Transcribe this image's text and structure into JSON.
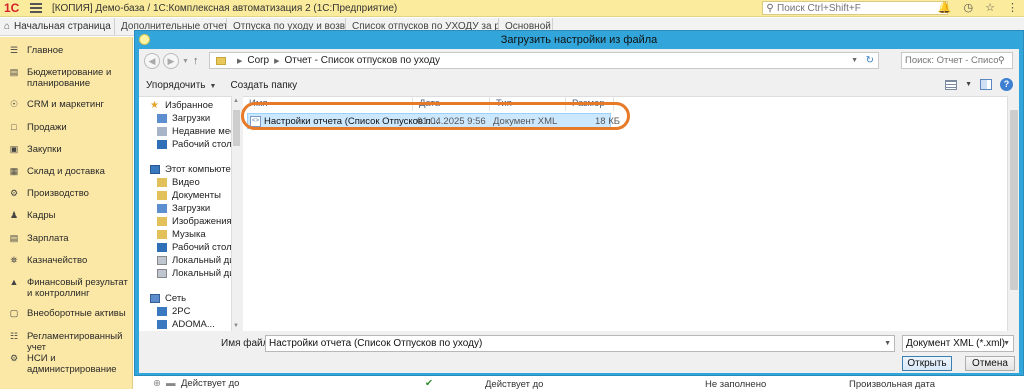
{
  "app": {
    "logo": "1С",
    "title": "[КОПИЯ] Демо-база / 1С:Комплексная автоматизация 2  (1С:Предприятие)",
    "search_placeholder": "Поиск Ctrl+Shift+F"
  },
  "tabs": {
    "home": "Начальная страница",
    "items": [
      "Дополнительные отчеты и обработки",
      "Отпуска по уходу и возврат из отпуска",
      "Список отпусков по УХОДУ за ребенком (Дополнительный отчет)",
      "Основной"
    ]
  },
  "sidebar": {
    "items": [
      {
        "label": "Главное",
        "icon": "menu-icon"
      },
      {
        "label": "Бюджетирование и планирование",
        "icon": "budget-icon"
      },
      {
        "label": "CRM и маркетинг",
        "icon": "crm-icon"
      },
      {
        "label": "Продажи",
        "icon": "sales-icon"
      },
      {
        "label": "Закупки",
        "icon": "purchases-icon"
      },
      {
        "label": "Склад и доставка",
        "icon": "warehouse-icon"
      },
      {
        "label": "Производство",
        "icon": "production-icon"
      },
      {
        "label": "Кадры",
        "icon": "hr-icon"
      },
      {
        "label": "Зарплата",
        "icon": "salary-icon"
      },
      {
        "label": "Казначейство",
        "icon": "treasury-icon"
      },
      {
        "label": "Финансовый результат и контроллинг",
        "icon": "finance-icon"
      },
      {
        "label": "Внеоборотные активы",
        "icon": "assets-icon"
      },
      {
        "label": "Регламентированный учет",
        "icon": "accounting-icon"
      },
      {
        "label": "НСИ и администрирование",
        "icon": "admin-icon"
      }
    ]
  },
  "background": {
    "row_text_left": "Действует до",
    "row_text_mid": "Действует до",
    "row_text_right1": "Не заполнено",
    "row_text_right2": "Произвольная дата",
    "edge_text": "Те"
  },
  "dialog": {
    "title": "Загрузить настройки из файла",
    "address": {
      "parts": [
        "Corp",
        "Отчет - Список отпусков по уходу"
      ]
    },
    "search_placeholder": "Поиск: Отчет - Список отпу...",
    "toolbar": {
      "organize": "Упорядочить",
      "new_folder": "Создать папку"
    },
    "nav": {
      "favorites_header": "Избранное",
      "favorites": [
        "Загрузки",
        "Недавние места",
        "Рабочий стол"
      ],
      "computer_header": "Этот компьютер",
      "computer": [
        "Видео",
        "Документы",
        "Загрузки",
        "Изображения",
        "Музыка",
        "Рабочий стол",
        "Локальный диск",
        "Локальный диск"
      ],
      "network_header": "Сеть",
      "network": [
        "2PC",
        "ADOMA..."
      ]
    },
    "columns": {
      "name": "Имя",
      "date": "Дата изменения",
      "type": "Тип",
      "size": "Размер"
    },
    "files": [
      {
        "name": "Настройки отчета (Список Отпусков п...",
        "date": "01.04.2025 9:56",
        "type": "Документ XML",
        "size": "18 КБ"
      }
    ],
    "filename_label": "Имя файла:",
    "filename_value": "Настройки отчета (Список Отпусков по уходу)",
    "filetype_value": "Документ XML (*.xml)",
    "open_button": "Открыть",
    "cancel_button": "Отмена"
  },
  "colors": {
    "dialog_border": "#32a6db",
    "highlight": "#e67a28",
    "selection": "#cce8ff",
    "sidebar_bg": "#fbe8a6",
    "titlebar_bg": "#fbeb9c"
  }
}
